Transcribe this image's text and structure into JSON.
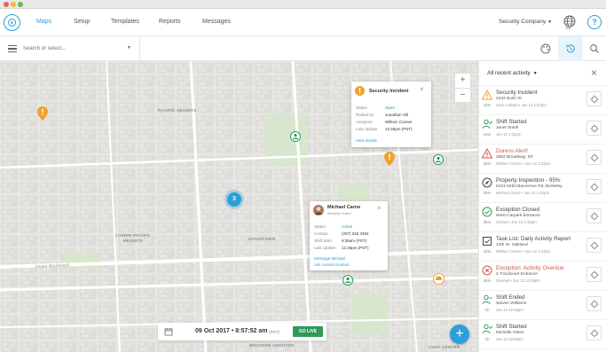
{
  "colors": {
    "accent": "#2a9fd8",
    "live": "#2f9a56",
    "incident": "#f0a030",
    "alert": "#d9534f"
  },
  "nav": {
    "items": [
      "Maps",
      "Setup",
      "Templates",
      "Reports",
      "Messages"
    ],
    "active": "Maps",
    "company": "Security Company",
    "globe_label": "EN"
  },
  "toolbar": {
    "search_placeholder": "Search or select..."
  },
  "map": {
    "labels": {
      "pacific_heights": "PACIFIC HEIGHTS",
      "lower_pacific_heights": "LOWER PACIFIC HEIGHTS",
      "japantown": "JAPANTOWN",
      "western_addition": "WESTERN ADDITION",
      "civic_center": "CIVIC CENTER",
      "geary": "Geary Boulevard"
    },
    "cluster_count": "3",
    "zoom_in": "+",
    "zoom_out": "−",
    "incident_popup": {
      "title": "Security Incident",
      "status_label": "Status",
      "status_value": "Open",
      "raised_label": "Raised by",
      "raised_value": "Jonathan Hill",
      "assigned_label": "Assigned",
      "assigned_value": "William Conner",
      "updated_label": "Last Update",
      "updated_value": "12:45pm (PST)",
      "link": "View details"
    },
    "guard_popup": {
      "name": "Michael Carne",
      "role": "Security Guard",
      "status_label": "Status",
      "status_value": "Active",
      "contact_label": "Contact",
      "contact_value": "(207) 225 3394",
      "shift_label": "Shift Start",
      "shift_value": "9:35am (PST)",
      "updated_label": "Last Update",
      "updated_value": "12:46pm (PST)",
      "link_message": "Message Michael",
      "link_location": "Ask current location"
    },
    "timebar": {
      "date": "09 Oct 2017 • 8:57:52 am",
      "tz": "(PDT)",
      "go_live": "GO LIVE"
    },
    "fab": "+"
  },
  "panel": {
    "title": "All recent activity",
    "close": "×",
    "items": [
      {
        "icon": "warning-icon",
        "ago": "10m",
        "title": "Security Incident",
        "sub": "2234 Bush St",
        "meta": "Jack Collado • Jan 13 1:47pm",
        "red": false
      },
      {
        "icon": "person-check-icon",
        "ago": "15m",
        "title": "Shift Started",
        "sub": "Janet Smith",
        "meta": "Jan 12 1:32pm",
        "red": false
      },
      {
        "icon": "alert-triangle-icon",
        "ago": "25m",
        "title": "Duress Alert!",
        "sub": "2554 Broadway, NY",
        "meta": "William Conner • Jan 12 1:22pm",
        "red": true
      },
      {
        "icon": "compass-icon",
        "ago": "30m",
        "title": "Property Inspection - 95%",
        "sub": "5431-6453 Banvenue Rd, Berkeley",
        "meta": "Michael Carne • Jan 12 1:23pm",
        "red": false
      },
      {
        "icon": "check-circle-icon",
        "ago": "36m",
        "title": "Exception Closed",
        "sub": "West Carpark Entrance",
        "meta": "Closed • Jan 12 1:18pm",
        "red": false
      },
      {
        "icon": "checklist-icon",
        "ago": "42m",
        "title": "Task List: Daily Activity Report",
        "sub": "12th St. Oakland",
        "meta": "William Conner • Jan 12 1:13pm",
        "red": false
      },
      {
        "icon": "x-circle-icon",
        "ago": "48m",
        "title": "Exception: Activity Overdue",
        "sub": "C Foodcourt Entrance",
        "meta": "Opened • Jan 12 12:59pm",
        "red": true
      },
      {
        "icon": "person-out-icon",
        "ago": "1h",
        "title": "Shift Ended",
        "sub": "Steven Williams",
        "meta": "Jan 12 12:43pm",
        "red": false
      },
      {
        "icon": "person-check-icon",
        "ago": "1h",
        "title": "Shift Started",
        "sub": "Michelle Oliver",
        "meta": "Jan 12 10:00am",
        "red": false
      }
    ]
  }
}
